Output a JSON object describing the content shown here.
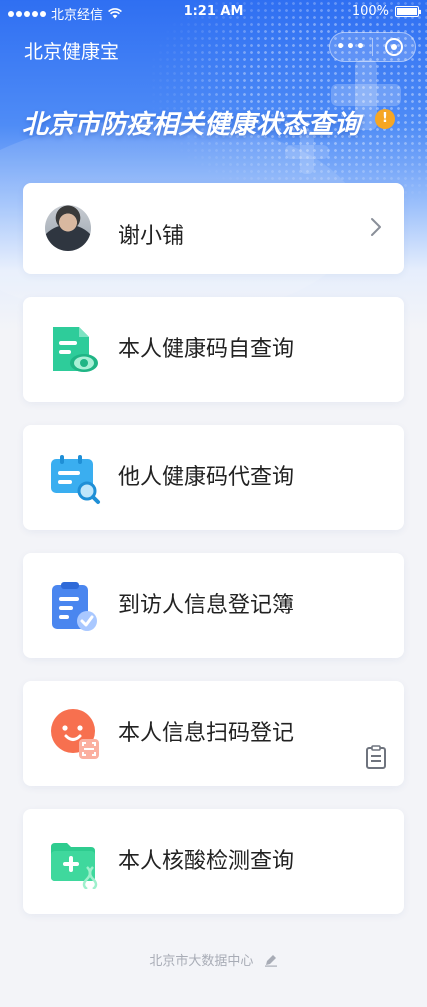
{
  "status_bar": {
    "carrier": "北京经信",
    "time": "1:21 AM",
    "battery": "100%"
  },
  "header": {
    "app_title": "北京健康宝",
    "main_title": "北京市防疫相关健康状态查询",
    "alert_icon_text": "!"
  },
  "user": {
    "name": "谢小铺"
  },
  "menu": {
    "items": [
      {
        "label": "本人健康码自查询",
        "icon": "doc-eye-icon",
        "color": "#2ecc9a"
      },
      {
        "label": "他人健康码代查询",
        "icon": "calendar-search-icon",
        "color": "#3aaef0"
      },
      {
        "label": "到访人信息登记簿",
        "icon": "clipboard-check-icon",
        "color": "#4a86ef"
      },
      {
        "label": "本人信息扫码登记",
        "icon": "smile-scan-icon",
        "color": "#f7704f"
      },
      {
        "label": "本人核酸检测查询",
        "icon": "folder-plus-dna-icon",
        "color": "#2ecc8f"
      }
    ]
  },
  "footer": {
    "text": "北京市大数据中心"
  }
}
